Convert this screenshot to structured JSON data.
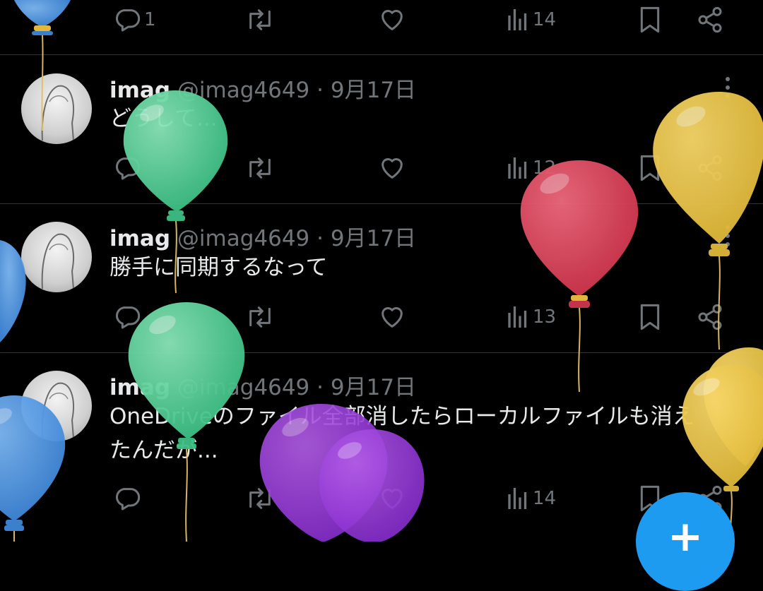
{
  "top_actions": {
    "reply_count": "1",
    "views_count": "14"
  },
  "tweets": [
    {
      "name": "imag",
      "handle": "@imag4649",
      "separator": "·",
      "date": "9月17日",
      "text_lines": [
        "どうして..."
      ],
      "reply_count": "",
      "views_count": "12"
    },
    {
      "name": "imag",
      "handle": "@imag4649",
      "separator": "·",
      "date": "9月17日",
      "text_lines": [
        "勝手に同期するなって"
      ],
      "reply_count": "",
      "views_count": "13"
    },
    {
      "name": "imag",
      "handle": "@imag4649",
      "separator": "·",
      "date": "9月17日",
      "text_lines": [
        "OneDriveのファイル全部消したらローカルファイルも消え",
        "たんだが..."
      ],
      "reply_count": "",
      "views_count": "14"
    }
  ],
  "fab": {
    "label": "+"
  },
  "colors": {
    "background": "#000000",
    "text": "#e7e9ea",
    "muted": "#71767b",
    "divider": "#2f3336",
    "accent": "#1d9bf0"
  },
  "icons": [
    "reply-icon",
    "retweet-icon",
    "like-icon",
    "views-icon",
    "bookmark-icon",
    "share-icon",
    "more-icon",
    "plus-icon"
  ]
}
